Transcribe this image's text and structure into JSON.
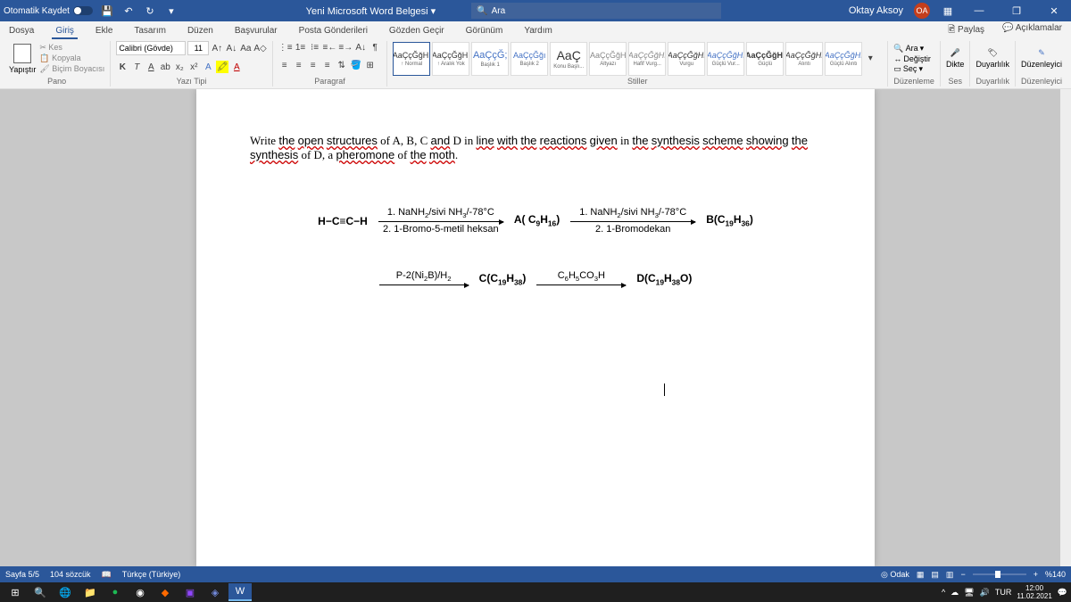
{
  "titlebar": {
    "autosave": "Otomatik Kaydet",
    "doc_title": "Yeni Microsoft Word Belgesi",
    "search_placeholder": "Ara",
    "user_name": "Oktay Aksoy",
    "user_initials": "OA"
  },
  "tabs": {
    "dosya": "Dosya",
    "giris": "Giriş",
    "ekle": "Ekle",
    "tasarim": "Tasarım",
    "duzen": "Düzen",
    "basvurular": "Başvurular",
    "posta": "Posta Gönderileri",
    "gozden": "Gözden Geçir",
    "gorunum": "Görünüm",
    "yardim": "Yardım",
    "paylas": "Paylaş",
    "aciklamalar": "Açıklamalar"
  },
  "ribbon": {
    "yapistir": "Yapıştır",
    "kes": "Kes",
    "kopyala": "Kopyala",
    "bicim": "Biçim Boyacısı",
    "pano": "Pano",
    "font_name": "Calibri (Gövde)",
    "font_size": "11",
    "yazi_tipi": "Yazı Tipi",
    "paragraf": "Paragraf",
    "stiller": "Stiller",
    "styles": [
      {
        "preview": "AaÇçĞğHı",
        "name": "↑ Normal"
      },
      {
        "preview": "AaÇçĞğHı",
        "name": "↑ Aralık Yok"
      },
      {
        "preview": "AaÇçĞ;",
        "name": "Başlık 1"
      },
      {
        "preview": "AaÇçĞğı",
        "name": "Başlık 2"
      },
      {
        "preview": "AaÇ",
        "name": "Konu Başlı..."
      },
      {
        "preview": "AaÇçĞğH",
        "name": "Altyazı"
      },
      {
        "preview": "AaÇçĞğHı",
        "name": "Hafif Vurg..."
      },
      {
        "preview": "AaÇçĞğHı",
        "name": "Vurgu"
      },
      {
        "preview": "AaÇçĞğHı",
        "name": "Güçlü Vur..."
      },
      {
        "preview": "AaÇçĞğHı",
        "name": "Güçlü"
      },
      {
        "preview": "AaÇçĞğHı",
        "name": "Alıntı"
      },
      {
        "preview": "AaÇçĞğHı",
        "name": "Güçlü Alıntı"
      }
    ],
    "ara": "Ara",
    "degistir": "Değiştir",
    "sec": "Seç",
    "duzenleme": "Düzenleme",
    "dikte": "Dikte",
    "ses": "Ses",
    "duyarlilik": "Duyarlılık",
    "duzenleyici": "Düzenleyici"
  },
  "document": {
    "question": "Write the open structures of A, B, C and D in line with the reactions given in the synthesis scheme showing the synthesis of D, a pheromone of the moth.",
    "start": "H−C≡C−H",
    "r1_cond1": "1. NaNH₂/sivi NH₃/-78°C",
    "r1_cond2": "2. 1-Bromo-5-metil heksan",
    "A": "A( C₉H₁₆)",
    "r2_cond1": "1. NaNH₂/sivi NH₃/-78°C",
    "r2_cond2": "2. 1-Bromodekan",
    "B": "B(C₁₉H₃₆)",
    "r3_cond": "P-2(Ni₂B)/H₂",
    "C": "C(C₁₉H₃₈)",
    "r4_cond": "C₆H₅CO₃H",
    "D": "D(C₁₉H₃₈O)"
  },
  "statusbar": {
    "page": "Sayfa 5/5",
    "words": "104 sözcük",
    "lang": "Türkçe (Türkiye)",
    "odak": "Odak",
    "zoom": "%140"
  },
  "taskbar": {
    "time": "12:00",
    "date": "11.02.2021"
  }
}
